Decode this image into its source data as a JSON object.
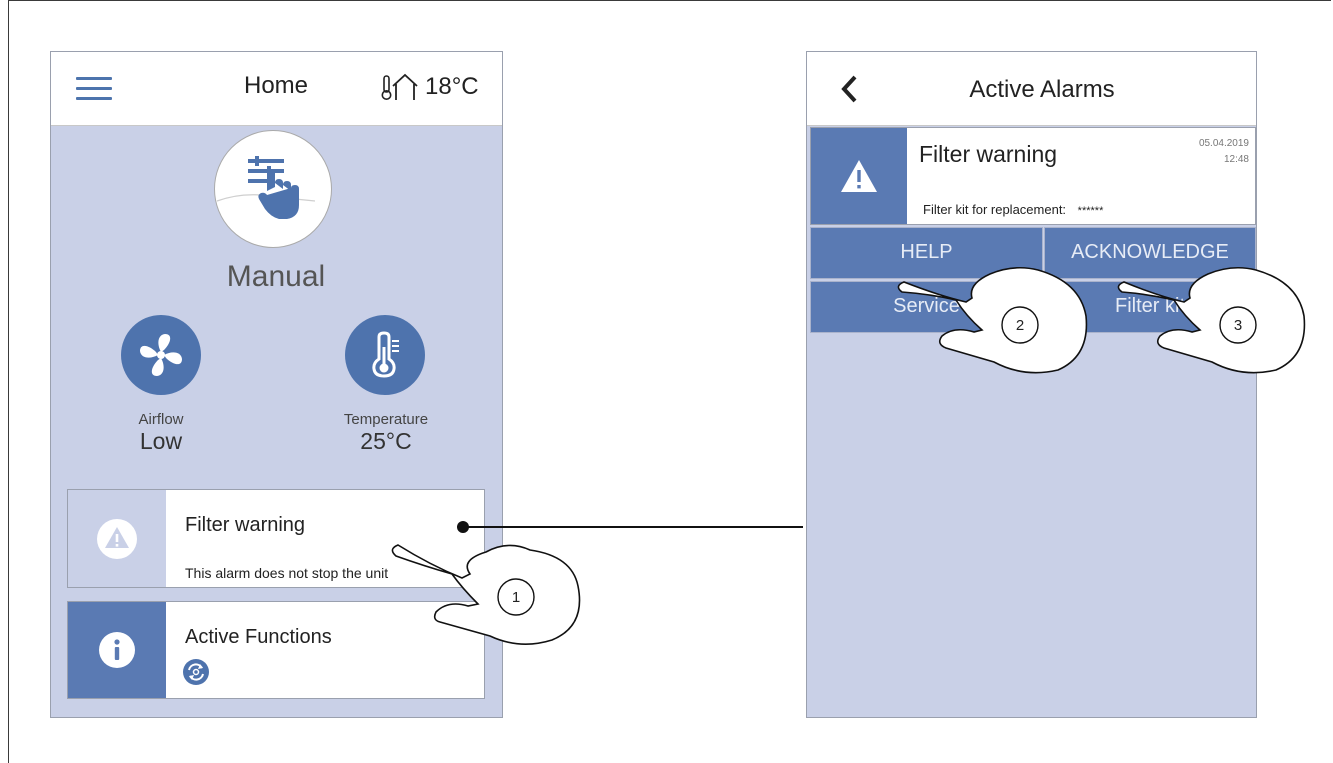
{
  "home": {
    "title": "Home",
    "temperature": "18°C",
    "mode": "Manual",
    "airflow": {
      "label": "Airflow",
      "value": "Low"
    },
    "temperature_setting": {
      "label": "Temperature",
      "value": "25°C"
    },
    "alarm_card": {
      "title": "Filter warning",
      "subtitle": "This alarm does not stop the unit"
    },
    "functions_card": {
      "title": "Active Functions"
    }
  },
  "alarms": {
    "title": "Active Alarms",
    "alarm": {
      "title": "Filter warning",
      "date": "05.04.2019",
      "time": "12:48",
      "desc_label": "Filter kit for replacement:",
      "desc_value": "******"
    },
    "buttons": {
      "help": "HELP",
      "acknowledge": "ACKNOWLEDGE",
      "service": "Service",
      "filter_kit": "Filter kit"
    }
  },
  "callouts": [
    "1",
    "2",
    "3"
  ],
  "colors": {
    "accent": "#4e73ad",
    "screen_bg": "#c9d0e7",
    "button": "#5a7ab3"
  }
}
